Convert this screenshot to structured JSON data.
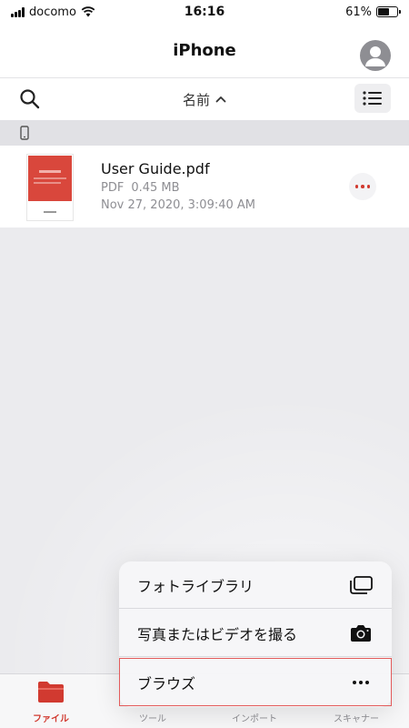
{
  "status_bar": {
    "carrier": "docomo",
    "time": "16:16",
    "battery_percent": "61%",
    "battery_level": 0.61
  },
  "nav": {
    "title": "iPhone"
  },
  "toolbar": {
    "sort_label": "名前",
    "sort_direction": "ascending"
  },
  "file": {
    "name": "User Guide.pdf",
    "type": "PDF",
    "size": "0.45 MB",
    "date": "Nov 27, 2020, 3:09:40 AM"
  },
  "popup": {
    "items": [
      {
        "label": "フォトライブラリ",
        "icon": "photo-library-icon"
      },
      {
        "label": "写真またはビデオを撮る",
        "icon": "camera-icon"
      },
      {
        "label": "ブラウズ",
        "icon": "more-icon"
      }
    ]
  },
  "tabs": [
    {
      "label": "ファイル",
      "icon": "folder-icon",
      "active": true
    },
    {
      "label": "ツール",
      "icon": "tools-icon",
      "active": false
    },
    {
      "label": "インポート",
      "icon": "import-icon",
      "active": false
    },
    {
      "label": "スキャナー",
      "icon": "scanner-icon",
      "active": false
    }
  ],
  "colors": {
    "accent": "#d13a30",
    "highlight": "#e35b5b"
  }
}
